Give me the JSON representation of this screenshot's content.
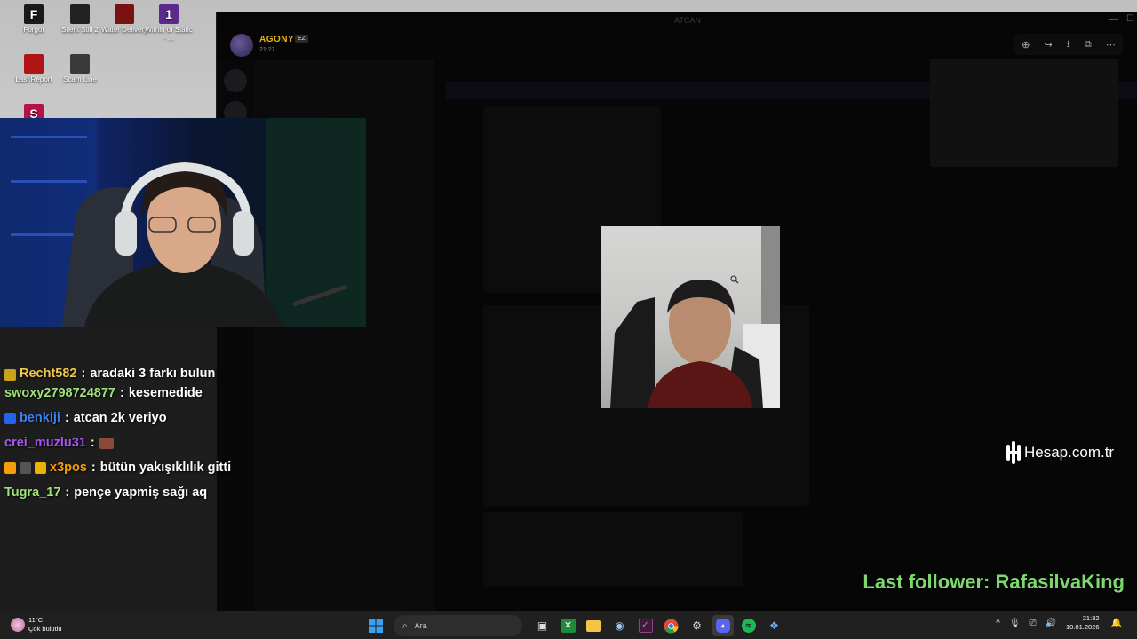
{
  "desktop": {
    "icons": [
      {
        "label": "Forgot",
        "glyph": "F",
        "color": "#1a1a1a"
      },
      {
        "label": "Silent Still 2",
        "glyph": "",
        "color": "#222222"
      },
      {
        "label": "Water Delivery",
        "glyph": "",
        "color": "#7a1212"
      },
      {
        "label": "Within of Static - ...",
        "glyph": "1",
        "color": "#5b2a8a"
      },
      {
        "label": "Last Report",
        "glyph": "",
        "color": "#b01515"
      },
      {
        "label": "Scam Line",
        "glyph": "",
        "color": "#3a3a3a"
      },
      {
        "label": "",
        "glyph": "S",
        "color": "#b3124a"
      }
    ]
  },
  "discord": {
    "window_title": "ATCAN",
    "viewer": {
      "username": "AGONY",
      "badge": "EZ",
      "time": "21:27"
    },
    "tools": [
      "zoom-in-icon",
      "share-icon",
      "download-icon",
      "open-external-icon",
      "more-icon"
    ]
  },
  "chat": {
    "messages": [
      {
        "user": "Recht582",
        "text": "aradaki 3 farkı bulun",
        "color": "#f2c94c",
        "badges": [
          "#caa21a"
        ],
        "partial": true
      },
      {
        "user": "swoxy2798724877",
        "text": "kesemedide",
        "color": "#9ee27a",
        "badges": []
      },
      {
        "user": "benkiji",
        "text": "atcan 2k veriyo",
        "color": "#3b82f6",
        "badges": [
          "#2563eb"
        ]
      },
      {
        "user": "crei_muzlu31",
        "text": "",
        "color": "#a855f7",
        "badges": [],
        "emote": true
      },
      {
        "user": "x3pos",
        "text": "bütün yakışıklılık gitti",
        "color": "#f59e0b",
        "badges": [
          "#f59e0b",
          "#555555",
          "#eab308"
        ]
      },
      {
        "user": "Tugra_17",
        "text": "pençe yapmiş sağı aq",
        "color": "#9ee27a",
        "badges": []
      }
    ]
  },
  "overlay": {
    "brand": "Hesap.com.tr",
    "follower_text": "Last follower: RafasilvaKing"
  },
  "taskbar": {
    "weather_temp": "11°C",
    "weather_desc": "Çok bulutlu",
    "search_placeholder": "Ara",
    "time": "21:32",
    "date": "10.01.2026",
    "apps": [
      "task-view-icon",
      "xbox-icon",
      "file-explorer-icon",
      "steam-icon",
      "vs-icon",
      "chrome-icon",
      "launcher-icon",
      "discord-icon",
      "spotify-icon",
      "settings-app-icon"
    ]
  }
}
